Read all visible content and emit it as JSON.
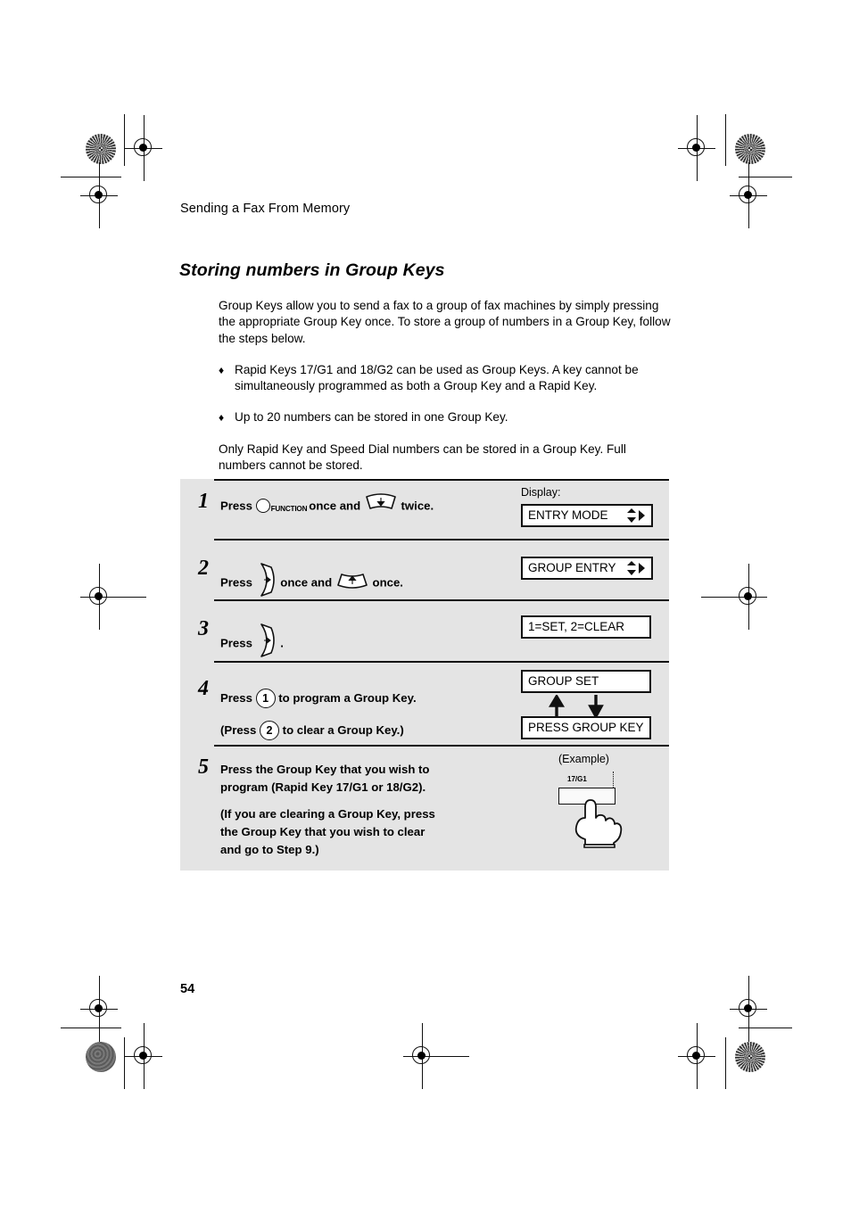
{
  "page": {
    "running_head": "Sending a Fax From Memory",
    "section_title": "Storing numbers in Group Keys",
    "page_number": "54"
  },
  "intro": {
    "paragraph": "Group Keys allow you to send a fax to a group of fax machines by simply pressing the appropriate Group Key once. To store a group of numbers in a Group Key, follow the steps below.",
    "bullets": [
      "Rapid Keys 17/G1 and 18/G2 can be used as Group Keys. A key cannot be simultaneously programmed as both a Group Key and a Rapid Key.",
      "Up to 20 numbers can be stored in one Group Key."
    ],
    "bullet_glyph": "♦",
    "closing_paragraph": "Only Rapid Key and Speed Dial numbers can be stored in a Group Key. Full numbers cannot be stored."
  },
  "steps": [
    {
      "number": "1",
      "text_before_icon1": "Press",
      "icon1_label": "FUNCTION",
      "text_middle": "once and",
      "text_after": "twice.",
      "display_label": "Display:",
      "display_value": "ENTRY MODE"
    },
    {
      "number": "2",
      "text_before_icon1": "Press",
      "text_middle": "once and",
      "text_after": "once.",
      "display_value": "GROUP ENTRY"
    },
    {
      "number": "3",
      "text_before_icon1": "Press",
      "text_after": ".",
      "display_value": "1=SET, 2=CLEAR"
    },
    {
      "number": "4",
      "line1_before": "Press",
      "key1": "1",
      "line1_after": "to program a Group Key.",
      "line2_before": "(Press",
      "key2": "2",
      "line2_after": "to clear a Group Key.)",
      "display_value_top": "GROUP SET",
      "display_value_bottom": "PRESS GROUP KEY"
    },
    {
      "number": "5",
      "lines": [
        "Press the Group Key that you wish to",
        "program (Rapid Key 17/G1 or 18/G2)."
      ],
      "lines2": [
        "(If you are clearing a Group Key, press",
        "the Group Key that you wish to clear",
        "and go to Step 9.)"
      ],
      "example_caption": "(Example)",
      "example_key_label": "17/G1"
    }
  ],
  "colors": {
    "panel_background": "#e4e4e4",
    "ink": "#000000",
    "page_background": "#ffffff"
  }
}
